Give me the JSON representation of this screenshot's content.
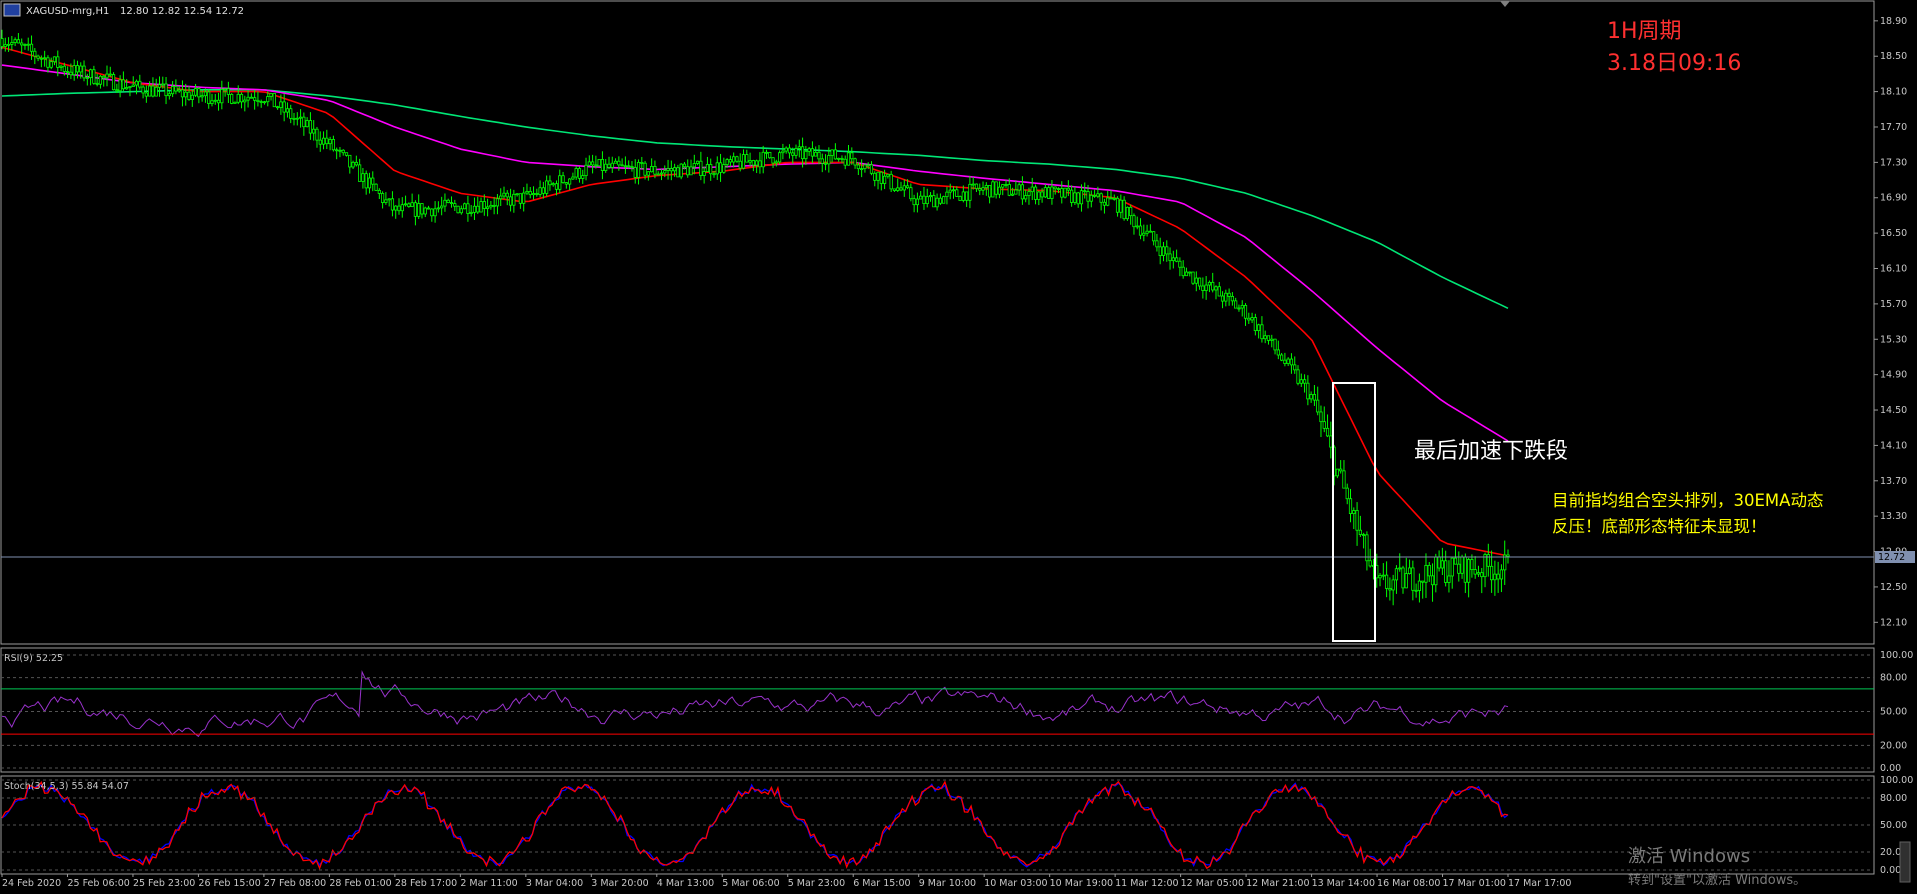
{
  "header": {
    "symbol": "XAGUSD-mrg,H1",
    "ohlc": "12.80 12.82 12.54 12.72"
  },
  "annotations": {
    "period": "1H周期",
    "datetime": "3.18日09:16",
    "segment": "最后加速下跌段",
    "comment_line1": "目前指均组合空头排列，30EMA动态",
    "comment_line2": "反压！底部形态特征未显现！"
  },
  "colors": {
    "background": "#000000",
    "candle": "#00ff00",
    "ema_fast": "#ff0000",
    "ema_mid": "#ff00ff",
    "ema_slow": "#00e676",
    "rsi_line": "#9932cc",
    "stoch_main": "#0000ff",
    "stoch_signal": "#ff0000",
    "rsi_upper_level": "#00c853",
    "rsi_lower_level": "#ff0000",
    "annotation_red": "#ff3030",
    "annotation_yellow": "#ffff00",
    "current_price_line": "#8090b0"
  },
  "price_axis": {
    "ticks": [
      "18.90",
      "18.50",
      "18.10",
      "17.70",
      "17.30",
      "16.90",
      "16.50",
      "16.10",
      "15.70",
      "15.30",
      "14.90",
      "14.50",
      "14.10",
      "13.70",
      "13.30",
      "12.90",
      "12.50",
      "12.10"
    ],
    "current_price_label": "12.72"
  },
  "rsi_panel": {
    "label": "RSI(9) 52.25",
    "ticks": [
      "100.00",
      "80.00",
      "50.00",
      "20.00",
      "0.00"
    ]
  },
  "stoch_panel": {
    "label": "Stoch(34,5,3) 55.84 54.07",
    "ticks": [
      "100.00",
      "80.00",
      "50.00",
      "20.00",
      "0.00"
    ]
  },
  "time_axis": {
    "labels": [
      "24 Feb 2020",
      "25 Feb 06:00",
      "25 Feb 23:00",
      "26 Feb 15:00",
      "27 Feb 08:00",
      "28 Feb 01:00",
      "28 Feb 17:00",
      "2 Mar 11:00",
      "3 Mar 04:00",
      "3 Mar 20:00",
      "4 Mar 13:00",
      "5 Mar 06:00",
      "5 Mar 23:00",
      "6 Mar 15:00",
      "9 Mar 10:00",
      "10 Mar 03:00",
      "10 Mar 19:00",
      "11 Mar 12:00",
      "12 Mar 05:00",
      "12 Mar 21:00",
      "13 Mar 14:00",
      "16 Mar 08:00",
      "17 Mar 01:00",
      "17 Mar 17:00"
    ]
  },
  "watermark": {
    "line1": "激活 Windows",
    "line2": "转到\"设置\"以激活 Windows。"
  },
  "chart_data": {
    "type": "candlestick",
    "symbol": "XAGUSD-mrg",
    "timeframe": "H1",
    "ylim": [
      11.9,
      19.0
    ],
    "current_price": 12.72,
    "price_path": [
      {
        "label": "24 Feb 2020",
        "close": 18.7
      },
      {
        "label": "25 Feb 06:00",
        "close": 18.35
      },
      {
        "label": "25 Feb 23:00",
        "close": 18.15
      },
      {
        "label": "26 Feb 15:00",
        "close": 18.05
      },
      {
        "label": "27 Feb 08:00",
        "close": 18.05
      },
      {
        "label": "28 Feb 01:00",
        "close": 17.5
      },
      {
        "label": "28 Feb 17:00",
        "close": 16.75
      },
      {
        "label": "2 Mar 11:00",
        "close": 16.8
      },
      {
        "label": "3 Mar 04:00",
        "close": 16.9
      },
      {
        "label": "3 Mar 20:00",
        "close": 17.25
      },
      {
        "label": "4 Mar 13:00",
        "close": 17.2
      },
      {
        "label": "5 Mar 06:00",
        "close": 17.25
      },
      {
        "label": "5 Mar 23:00",
        "close": 17.4
      },
      {
        "label": "6 Mar 15:00",
        "close": 17.35
      },
      {
        "label": "9 Mar 10:00",
        "close": 16.85
      },
      {
        "label": "10 Mar 03:00",
        "close": 17.0
      },
      {
        "label": "10 Mar 19:00",
        "close": 16.95
      },
      {
        "label": "11 Mar 12:00",
        "close": 16.85
      },
      {
        "label": "12 Mar 05:00",
        "close": 16.1
      },
      {
        "label": "12 Mar 21:00",
        "close": 15.6
      },
      {
        "label": "13 Mar 14:00",
        "close": 14.65
      },
      {
        "label": "16 Mar 08:00",
        "close": 12.5
      },
      {
        "label": "17 Mar 01:00",
        "close": 12.7
      },
      {
        "label": "17 Mar 17:00",
        "close": 12.72
      }
    ],
    "indicators": [
      {
        "name": "30EMA",
        "values": [
          18.6,
          18.4,
          18.2,
          18.1,
          18.1,
          17.85,
          17.2,
          16.95,
          16.85,
          17.05,
          17.15,
          17.2,
          17.3,
          17.3,
          17.05,
          17.0,
          16.98,
          16.9,
          16.55,
          16.0,
          15.3,
          13.8,
          13.0,
          12.85
        ]
      }
    ],
    "ema_mid": [
      18.4,
      18.3,
      18.2,
      18.15,
      18.12,
      18.0,
      17.7,
      17.45,
      17.3,
      17.25,
      17.22,
      17.25,
      17.28,
      17.3,
      17.2,
      17.12,
      17.05,
      16.98,
      16.85,
      16.45,
      15.85,
      15.2,
      14.6,
      14.15
    ],
    "ema_slow": [
      18.05,
      18.08,
      18.1,
      18.12,
      18.12,
      18.05,
      17.95,
      17.82,
      17.7,
      17.6,
      17.52,
      17.48,
      17.45,
      17.42,
      17.38,
      17.32,
      17.28,
      17.22,
      17.12,
      16.95,
      16.7,
      16.4,
      16.0,
      15.65
    ],
    "highlight_box": {
      "high": 14.75,
      "low": 11.95
    },
    "rsi_levels": [
      70,
      30
    ],
    "rsi_value": 52.25,
    "stoch_values": [
      55.84,
      54.07
    ]
  }
}
